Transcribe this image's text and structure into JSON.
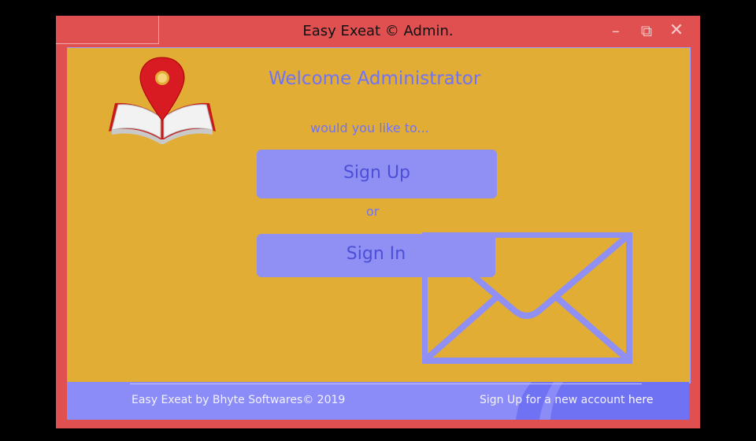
{
  "window": {
    "title": "Easy Exeat © Admin.",
    "controls": {
      "minimize": "–",
      "maximize": "⧉",
      "close": "✕"
    }
  },
  "main": {
    "welcome": "Welcome Administrator",
    "prompt": "would you like to...",
    "signup_label": "Sign Up",
    "or_label": "or",
    "signin_label": "Sign In"
  },
  "footer": {
    "copyright": "Easy Exeat by Bhyte Softwares© 2019",
    "signup_text": "Sign Up for a new account",
    "here_link": "here"
  },
  "colors": {
    "titlebar": "#e05050",
    "content_bg": "#e2ad35",
    "accent": "#8f8ff4",
    "text_accent": "#6f73f7"
  },
  "icons": {
    "logo": "map-pin-book-icon",
    "decor": "envelope-icon"
  }
}
